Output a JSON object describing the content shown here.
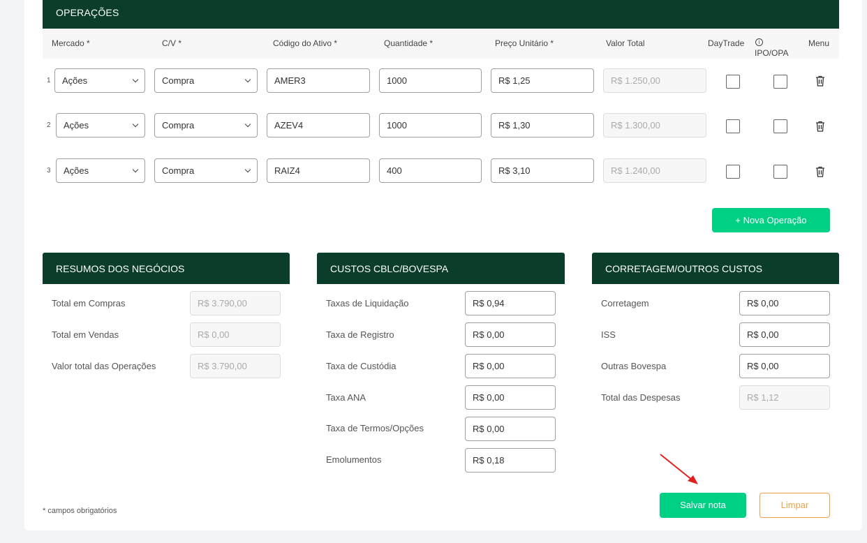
{
  "operacoes": {
    "title": "OPERAÇÕES",
    "columns": {
      "mercado": "Mercado *",
      "cv": "C/V *",
      "codigo": "Código do Ativo *",
      "quantidade": "Quantidade *",
      "preco": "Preço Unitário *",
      "valor_total": "Valor Total",
      "daytrade": "DayTrade",
      "ipo": "IPO/OPA",
      "menu": "Menu"
    },
    "rows": [
      {
        "num": "1",
        "mercado": "Ações",
        "cv": "Compra",
        "codigo": "AMER3",
        "quantidade": "1000",
        "preco": "R$ 1,25",
        "valor_total": "R$ 1.250,00"
      },
      {
        "num": "2",
        "mercado": "Ações",
        "cv": "Compra",
        "codigo": "AZEV4",
        "quantidade": "1000",
        "preco": "R$ 1,30",
        "valor_total": "R$ 1.300,00"
      },
      {
        "num": "3",
        "mercado": "Ações",
        "cv": "Compra",
        "codigo": "RAIZ4",
        "quantidade": "400",
        "preco": "R$ 3,10",
        "valor_total": "R$ 1.240,00"
      }
    ],
    "nova_operacao": "+ Nova Operação"
  },
  "resumos": {
    "title": "RESUMOS DOS NEGÓCIOS",
    "items": [
      {
        "label": "Total em Compras",
        "value": "R$ 3.790,00"
      },
      {
        "label": "Total em Vendas",
        "value": "R$ 0,00"
      },
      {
        "label": "Valor total das Operações",
        "value": "R$ 3.790,00"
      }
    ]
  },
  "custos": {
    "title": "CUSTOS CBLC/BOVESPA",
    "items": [
      {
        "label": "Taxas de Liquidação",
        "value": "R$ 0,94"
      },
      {
        "label": "Taxa de Registro",
        "value": "R$ 0,00"
      },
      {
        "label": "Taxa de Custódia",
        "value": "R$ 0,00"
      },
      {
        "label": "Taxa ANA",
        "value": "R$ 0,00"
      },
      {
        "label": "Taxa de Termos/Opções",
        "value": "R$ 0,00"
      },
      {
        "label": "Emolumentos",
        "value": "R$ 0,18"
      }
    ]
  },
  "corretagem": {
    "title": "CORRETAGEM/OUTROS CUSTOS",
    "items": [
      {
        "label": "Corretagem",
        "value": "R$ 0,00"
      },
      {
        "label": "ISS",
        "value": "R$ 0,00"
      },
      {
        "label": "Outras Bovespa",
        "value": "R$ 0,00"
      },
      {
        "label": "Total das Despesas",
        "value": "R$ 1,12"
      }
    ]
  },
  "footer": {
    "note": "* campos obrigatórios",
    "salvar": "Salvar nota",
    "limpar": "Limpar"
  },
  "colors": {
    "header_bg": "#0a3d2a",
    "primary_button": "#00d084",
    "secondary_button": "#e8a34a",
    "annotation_arrow": "#e02020"
  }
}
